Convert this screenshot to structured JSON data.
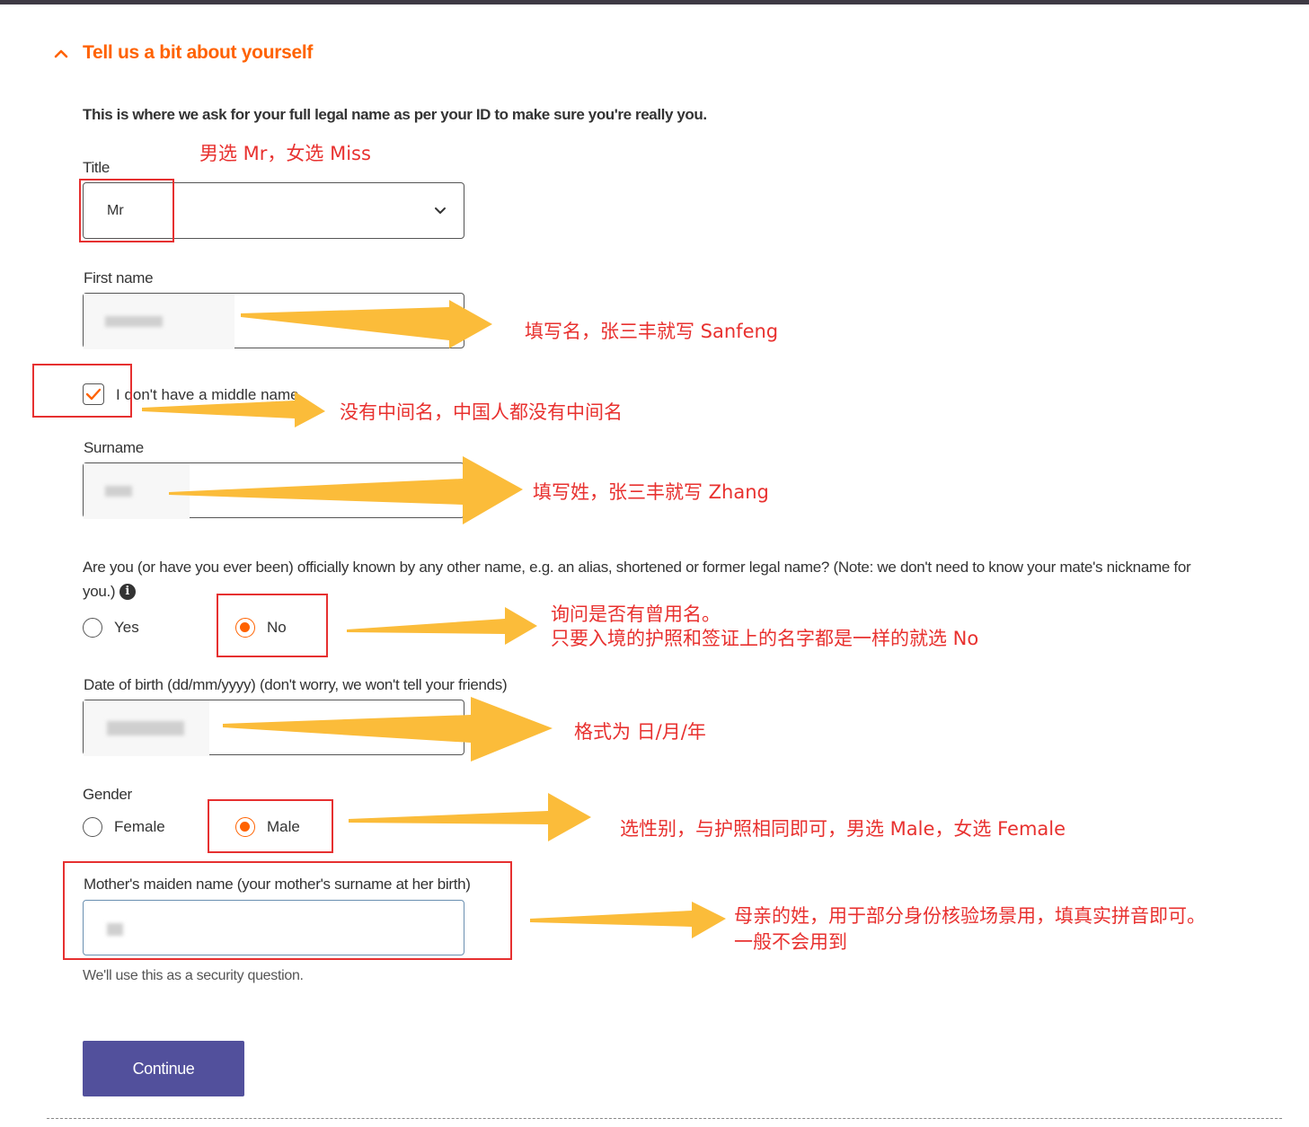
{
  "section": {
    "title": "Tell us a bit about yourself"
  },
  "intro": "This is where we ask for your full legal name as per your ID to make sure you're really you.",
  "title_field": {
    "label": "Title",
    "value": "Mr"
  },
  "first_name": {
    "label": "First name"
  },
  "middle_name": {
    "label": "I don't have a middle name",
    "checked": true
  },
  "surname": {
    "label": "Surname"
  },
  "alias": {
    "question": "Are you (or have you ever been) officially known by any other name, e.g. an alias, shortened or former legal name? (Note: we don't need to know your mate's nickname for you.)",
    "options": [
      "Yes",
      "No"
    ],
    "selected": "No"
  },
  "dob": {
    "label": "Date of birth (dd/mm/yyyy) (don't worry, we won't tell your friends)"
  },
  "gender": {
    "label": "Gender",
    "options": [
      "Female",
      "Male"
    ],
    "selected": "Male"
  },
  "maiden": {
    "label": "Mother's maiden name (your mother's surname at her birth)",
    "helper": "We'll use this as a security question."
  },
  "continue_label": "Continue",
  "annotations": {
    "title": "男选 Mr，女选 Miss",
    "first_name": "填写名，张三丰就写 Sanfeng",
    "middle_name": "没有中间名，中国人都没有中间名",
    "surname": "填写姓，张三丰就写 Zhang",
    "alias_line1": "询问是否有曾用名。",
    "alias_line2": "只要入境的护照和签证上的名字都是一样的就选 No",
    "dob": "格式为 日/月/年",
    "gender": "选性别，与护照相同即可，男选 Male，女选 Female",
    "maiden_line1": "母亲的姓，用于部分身份核验场景用，填真实拼音即可。",
    "maiden_line2": "一般不会用到"
  },
  "colors": {
    "accent": "#ff6200",
    "button": "#52509c",
    "annotation": "#e8312f",
    "arrow": "#fbbc3a"
  }
}
